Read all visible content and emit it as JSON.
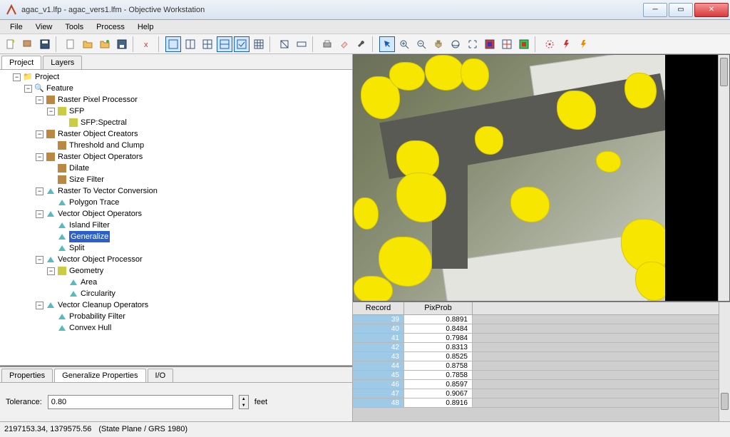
{
  "window": {
    "title": "agac_v1.lfp - agac_vers1.lfm - Objective Workstation",
    "minimize_tip": "Minimize",
    "maximize_tip": "Maximize",
    "close_tip": "Close"
  },
  "menu": [
    "File",
    "View",
    "Tools",
    "Process",
    "Help"
  ],
  "panel_tabs": {
    "project": "Project",
    "layers": "Layers"
  },
  "tree": {
    "root": "Project",
    "feature": "Feature",
    "rpp": "Raster Pixel Processor",
    "sfp": "SFP",
    "sfp_spectral": "SFP:Spectral",
    "roc": "Raster Object Creators",
    "threshold": "Threshold and Clump",
    "roo": "Raster Object Operators",
    "dilate": "Dilate",
    "size_filter": "Size Filter",
    "rtv": "Raster To Vector Conversion",
    "poly_trace": "Polygon Trace",
    "voo": "Vector Object Operators",
    "island_filter": "Island Filter",
    "generalize": "Generalize",
    "split": "Split",
    "vop": "Vector Object Processor",
    "geometry": "Geometry",
    "area": "Area",
    "circularity": "Circularity",
    "vco": "Vector Cleanup Operators",
    "prob_filter": "Probability Filter",
    "convex_hull": "Convex Hull"
  },
  "props": {
    "tabs": {
      "properties": "Properties",
      "generalize": "Generalize Properties",
      "io": "I/O"
    },
    "tolerance_label": "Tolerance:",
    "tolerance_value": "0.80",
    "tolerance_unit": "feet"
  },
  "table": {
    "cols": {
      "record": "Record",
      "pixprob": "PixProb"
    },
    "rows": [
      {
        "rec": "39",
        "val": "0.8891"
      },
      {
        "rec": "40",
        "val": "0.8484"
      },
      {
        "rec": "41",
        "val": "0.7984"
      },
      {
        "rec": "42",
        "val": "0.8313"
      },
      {
        "rec": "43",
        "val": "0.8525"
      },
      {
        "rec": "44",
        "val": "0.8758"
      },
      {
        "rec": "45",
        "val": "0.7858"
      },
      {
        "rec": "46",
        "val": "0.8597"
      },
      {
        "rec": "47",
        "val": "0.9067"
      },
      {
        "rec": "48",
        "val": "0.8916"
      }
    ]
  },
  "status": {
    "coords": "2197153.34, 1379575.56",
    "proj": "(State Plane / GRS 1980)"
  },
  "colors": {
    "highlight_yellow": "#f7e600",
    "selection_blue": "#2a60c8"
  }
}
